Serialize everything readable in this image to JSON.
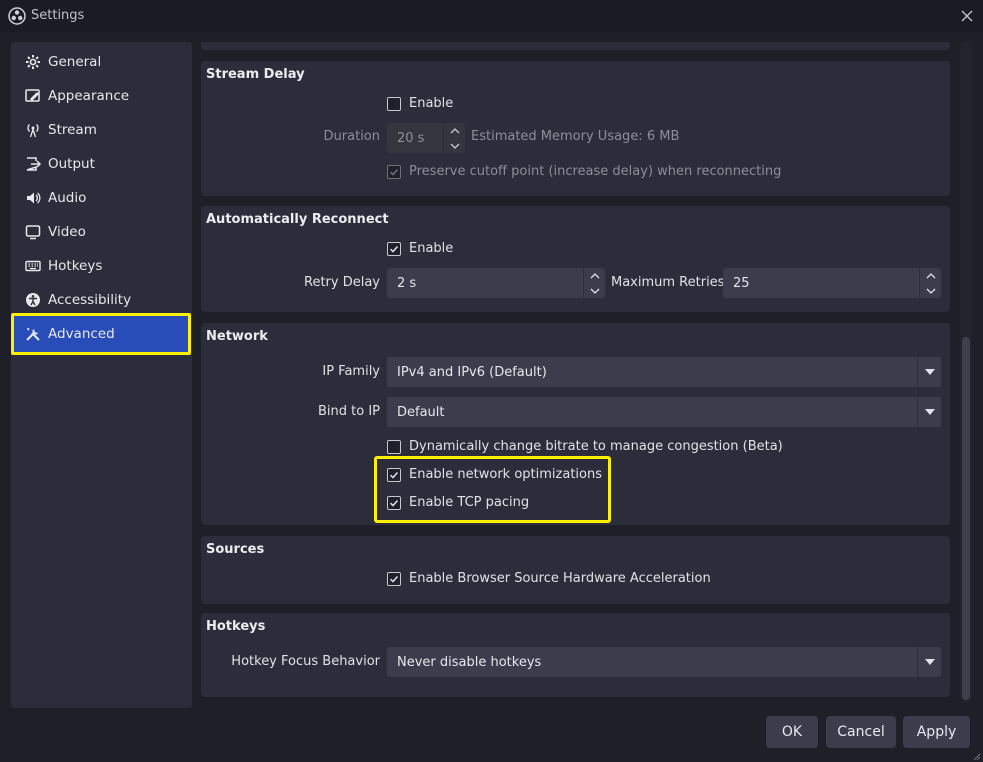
{
  "window": {
    "title": "Settings"
  },
  "sidebar": {
    "items": [
      {
        "label": "General",
        "icon": "gear-icon"
      },
      {
        "label": "Appearance",
        "icon": "appearance-icon"
      },
      {
        "label": "Stream",
        "icon": "antenna-icon"
      },
      {
        "label": "Output",
        "icon": "output-icon"
      },
      {
        "label": "Audio",
        "icon": "speaker-icon"
      },
      {
        "label": "Video",
        "icon": "monitor-icon"
      },
      {
        "label": "Hotkeys",
        "icon": "keyboard-icon"
      },
      {
        "label": "Accessibility",
        "icon": "accessibility-icon"
      },
      {
        "label": "Advanced",
        "icon": "wrench-screwdriver-icon"
      }
    ],
    "active": "Advanced"
  },
  "stream_delay": {
    "title": "Stream Delay",
    "enable_label": "Enable",
    "enable_checked": false,
    "duration_label": "Duration",
    "duration_value": "20 s",
    "memory_text": "Estimated Memory Usage: 6 MB",
    "preserve_label": "Preserve cutoff point (increase delay) when reconnecting",
    "preserve_checked": true
  },
  "auto_reconnect": {
    "title": "Automatically Reconnect",
    "enable_label": "Enable",
    "enable_checked": true,
    "retry_delay_label": "Retry Delay",
    "retry_delay_value": "2 s",
    "max_retries_label": "Maximum Retries",
    "max_retries_value": "25"
  },
  "network": {
    "title": "Network",
    "ip_family_label": "IP Family",
    "ip_family_value": "IPv4 and IPv6 (Default)",
    "bind_ip_label": "Bind to IP",
    "bind_ip_value": "Default",
    "dynamic_bitrate_label": "Dynamically change bitrate to manage congestion (Beta)",
    "dynamic_bitrate_checked": false,
    "net_opt_label": "Enable network optimizations",
    "net_opt_checked": true,
    "tcp_pacing_label": "Enable TCP pacing",
    "tcp_pacing_checked": true
  },
  "sources": {
    "title": "Sources",
    "browser_hw_label": "Enable Browser Source Hardware Acceleration",
    "browser_hw_checked": true
  },
  "hotkeys": {
    "title": "Hotkeys",
    "focus_label": "Hotkey Focus Behavior",
    "focus_value": "Never disable hotkeys"
  },
  "buttons": {
    "ok": "OK",
    "cancel": "Cancel",
    "apply": "Apply"
  },
  "colors": {
    "highlight": "#ffef00",
    "active_item": "#284cb8",
    "panel": "#2b2d3a",
    "background": "#1e1f29"
  }
}
